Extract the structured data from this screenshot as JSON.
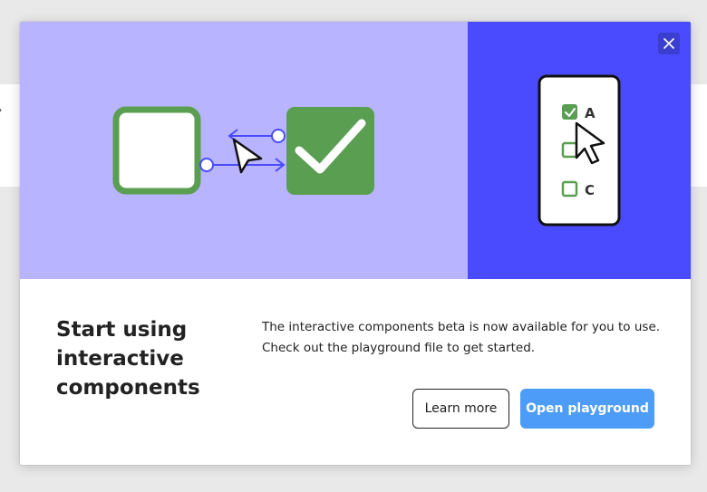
{
  "modal": {
    "title": "Start using interactive components",
    "description": "The interactive components beta is now available for you to use. Check out the playground file to get started.",
    "learn_more_label": "Learn more",
    "open_playground_label": "Open playground"
  },
  "illustration": {
    "checklist_options": [
      "A",
      "",
      "C"
    ],
    "checked_option": "A"
  },
  "colors": {
    "hero_left_bg": "#b8b4ff",
    "hero_right_bg": "#4a4bff",
    "component_green": "#5a9e52",
    "connector_blue": "#4a4bff",
    "primary_button": "#4d9cf7",
    "close_button_bg": "#3b3fcf"
  },
  "icons": {
    "close": "close-icon",
    "cursor": "cursor-arrow-icon",
    "checkmark": "checkmark-icon"
  }
}
